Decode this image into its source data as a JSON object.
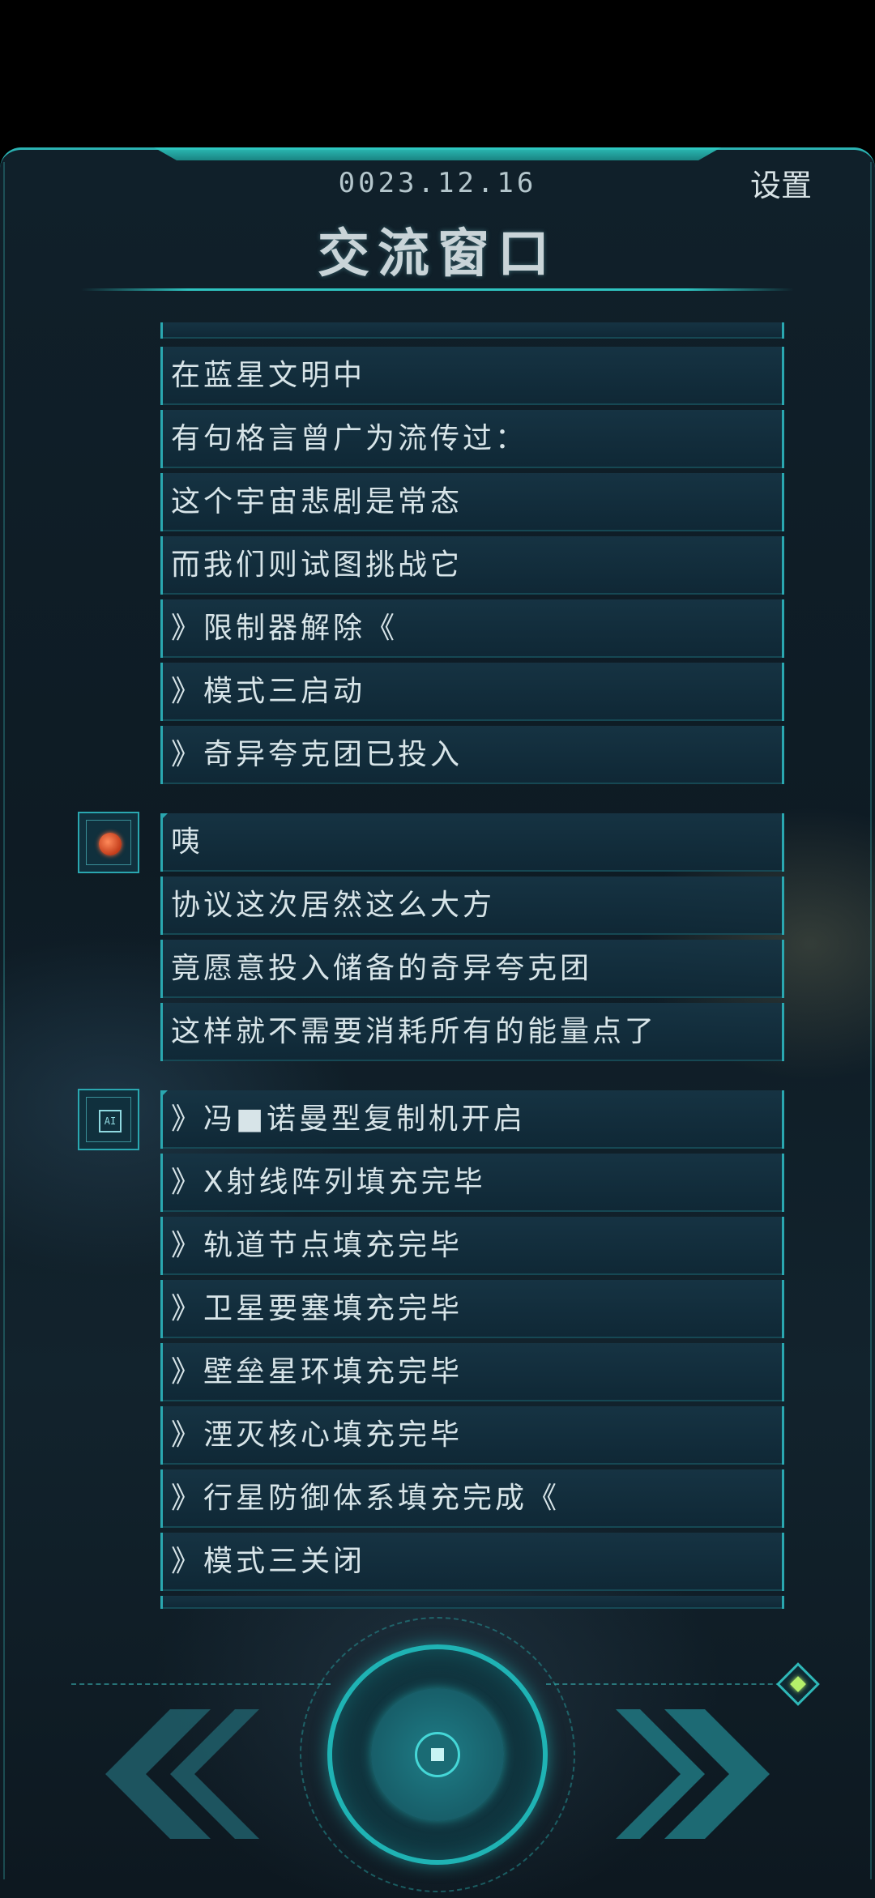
{
  "header": {
    "date": "0023.12.16",
    "settings_label": "设置",
    "title": "交流窗口"
  },
  "messages": {
    "group1": [
      "在蓝星文明中",
      "有句格言曾广为流传过：",
      "这个宇宙悲剧是常态",
      "而我们则试图挑战它",
      "》限制器解除《",
      "》模式三启动",
      "》奇异夸克团已投入"
    ],
    "group2": [
      "咦",
      "协议这次居然这么大方",
      "竟愿意投入储备的奇异夸克团",
      "这样就不需要消耗所有的能量点了"
    ],
    "group3": [
      "》冯■诺曼型复制机开启",
      "》X射线阵列填充完毕",
      "》轨道节点填充完毕",
      "》卫星要塞填充完毕",
      "》壁垒星环填充完毕",
      "》湮灭核心填充完毕",
      "》行星防御体系填充完成《",
      "》模式三关闭"
    ]
  },
  "avatars": {
    "group2": "orange-core-avatar-icon",
    "group3": "ai-chip-avatar-icon"
  },
  "controls": {
    "prev": "double-left-arrow-icon",
    "next": "double-right-arrow-icon",
    "center": "center-action-button",
    "corner": "diamond-gem-icon"
  },
  "colors": {
    "accent": "#2aa7b0",
    "bubble": "#163444",
    "text": "#d7e4e8"
  }
}
